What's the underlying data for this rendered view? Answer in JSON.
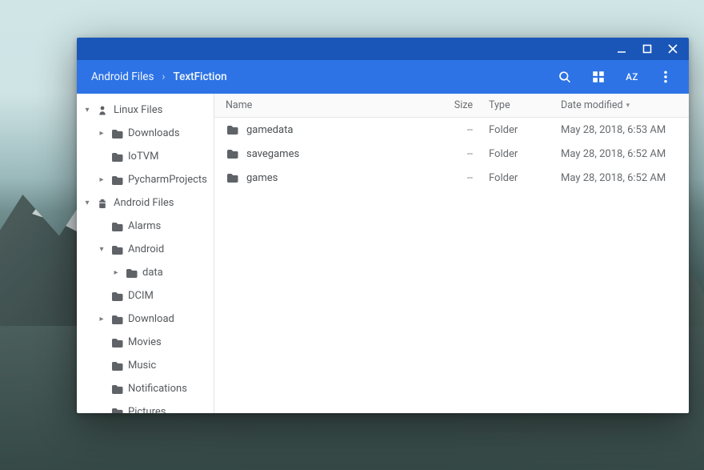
{
  "breadcrumb": {
    "root": "Android Files",
    "current": "TextFiction"
  },
  "toolbar": {
    "sort_label": "AZ"
  },
  "columns": {
    "name": "Name",
    "size": "Size",
    "type": "Type",
    "date": "Date modified"
  },
  "sidebar": [
    {
      "label": "Linux Files",
      "iconKind": "linux",
      "indent": 0,
      "expand": "down"
    },
    {
      "label": "Downloads",
      "iconKind": "folder",
      "indent": 1,
      "expand": "right"
    },
    {
      "label": "IoTVM",
      "iconKind": "folder",
      "indent": 1,
      "expand": "none"
    },
    {
      "label": "PycharmProjects",
      "iconKind": "folder",
      "indent": 1,
      "expand": "right"
    },
    {
      "label": "Android Files",
      "iconKind": "android",
      "indent": 0,
      "expand": "down"
    },
    {
      "label": "Alarms",
      "iconKind": "folder",
      "indent": 1,
      "expand": "none"
    },
    {
      "label": "Android",
      "iconKind": "folder",
      "indent": 1,
      "expand": "down"
    },
    {
      "label": "data",
      "iconKind": "folder",
      "indent": 2,
      "expand": "right"
    },
    {
      "label": "DCIM",
      "iconKind": "folder",
      "indent": 1,
      "expand": "none"
    },
    {
      "label": "Download",
      "iconKind": "folder",
      "indent": 1,
      "expand": "right"
    },
    {
      "label": "Movies",
      "iconKind": "folder",
      "indent": 1,
      "expand": "none"
    },
    {
      "label": "Music",
      "iconKind": "folder",
      "indent": 1,
      "expand": "none"
    },
    {
      "label": "Notifications",
      "iconKind": "folder",
      "indent": 1,
      "expand": "none"
    },
    {
      "label": "Pictures",
      "iconKind": "folder",
      "indent": 1,
      "expand": "none"
    }
  ],
  "rows": [
    {
      "name": "gamedata",
      "size": "--",
      "type": "Folder",
      "date": "May 28, 2018, 6:53 AM"
    },
    {
      "name": "savegames",
      "size": "--",
      "type": "Folder",
      "date": "May 28, 2018, 6:52 AM"
    },
    {
      "name": "games",
      "size": "--",
      "type": "Folder",
      "date": "May 28, 2018, 6:52 AM"
    }
  ]
}
